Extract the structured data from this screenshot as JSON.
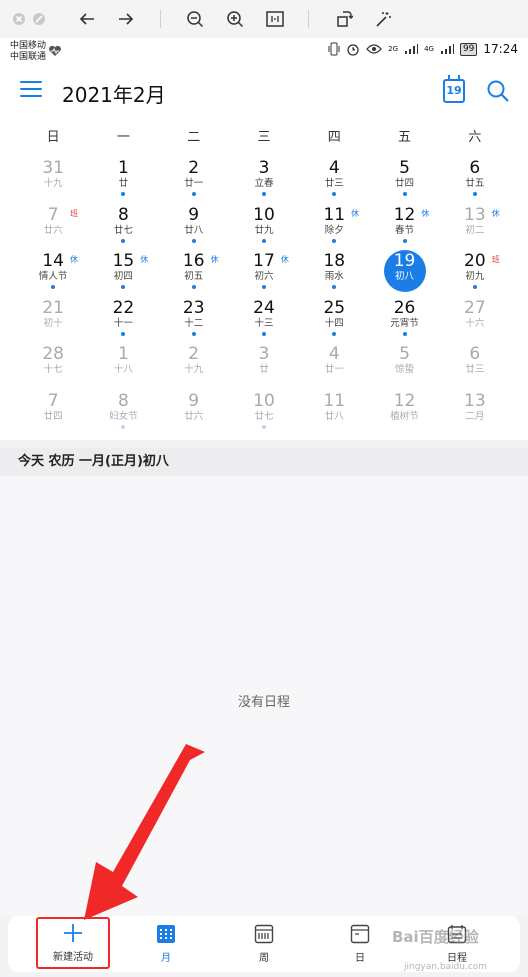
{
  "status": {
    "carrier1": "中国移动",
    "carrier2": "中国联通",
    "net1": "2G",
    "net2": "4G",
    "battery": "99",
    "time": "17:24"
  },
  "header": {
    "title": "2021年2月",
    "today_num": "19"
  },
  "weekdays": [
    "日",
    "一",
    "二",
    "三",
    "四",
    "五",
    "六"
  ],
  "calendar": {
    "selected_day": "19",
    "badge_work": "班",
    "badge_rest": "休",
    "rows": [
      [
        [
          "31",
          "十九",
          true,
          false,
          ""
        ],
        [
          "1",
          "廿",
          false,
          true,
          ""
        ],
        [
          "2",
          "廿一",
          false,
          true,
          ""
        ],
        [
          "3",
          "立春",
          false,
          true,
          ""
        ],
        [
          "4",
          "廿三",
          false,
          true,
          ""
        ],
        [
          "5",
          "廿四",
          false,
          true,
          ""
        ],
        [
          "6",
          "廿五",
          false,
          true,
          ""
        ]
      ],
      [
        [
          "7",
          "廿六",
          true,
          false,
          "ban"
        ],
        [
          "8",
          "廿七",
          false,
          true,
          ""
        ],
        [
          "9",
          "廿八",
          false,
          true,
          ""
        ],
        [
          "10",
          "廿九",
          false,
          true,
          ""
        ],
        [
          "11",
          "除夕",
          false,
          true,
          "xiu"
        ],
        [
          "12",
          "春节",
          false,
          true,
          "xiu"
        ],
        [
          "13",
          "初二",
          true,
          false,
          "xiu"
        ]
      ],
      [
        [
          "14",
          "情人节",
          false,
          true,
          "xiu"
        ],
        [
          "15",
          "初四",
          false,
          true,
          "xiu"
        ],
        [
          "16",
          "初五",
          false,
          true,
          "xiu"
        ],
        [
          "17",
          "初六",
          false,
          true,
          "xiu"
        ],
        [
          "18",
          "雨水",
          false,
          true,
          ""
        ],
        [
          "19",
          "初八",
          false,
          false,
          ""
        ],
        [
          "20",
          "初九",
          false,
          true,
          "ban"
        ]
      ],
      [
        [
          "21",
          "初十",
          true,
          false,
          ""
        ],
        [
          "22",
          "十一",
          false,
          true,
          ""
        ],
        [
          "23",
          "十二",
          false,
          true,
          ""
        ],
        [
          "24",
          "十三",
          false,
          true,
          ""
        ],
        [
          "25",
          "十四",
          false,
          true,
          ""
        ],
        [
          "26",
          "元宵节",
          false,
          true,
          ""
        ],
        [
          "27",
          "十六",
          true,
          false,
          ""
        ]
      ],
      [
        [
          "28",
          "十七",
          true,
          false,
          ""
        ],
        [
          "1",
          "十八",
          true,
          false,
          ""
        ],
        [
          "2",
          "十九",
          true,
          false,
          ""
        ],
        [
          "3",
          "廿",
          true,
          false,
          ""
        ],
        [
          "4",
          "廿一",
          true,
          false,
          ""
        ],
        [
          "5",
          "惊蛰",
          true,
          false,
          ""
        ],
        [
          "6",
          "廿三",
          true,
          false,
          ""
        ]
      ],
      [
        [
          "7",
          "廿四",
          true,
          false,
          ""
        ],
        [
          "8",
          "妇女节",
          true,
          true,
          ""
        ],
        [
          "9",
          "廿六",
          true,
          false,
          ""
        ],
        [
          "10",
          "廿七",
          true,
          true,
          ""
        ],
        [
          "11",
          "廿八",
          true,
          false,
          ""
        ],
        [
          "12",
          "植树节",
          true,
          false,
          ""
        ],
        [
          "13",
          "二月",
          true,
          false,
          ""
        ]
      ]
    ]
  },
  "agenda": {
    "header": "今天  农历 一月(正月)初八",
    "empty": "没有日程"
  },
  "nav": {
    "new": "新建活动",
    "month": "月",
    "week": "周",
    "day": "日",
    "schedule": "日程"
  },
  "watermark": {
    "brand": "Bai百度经验",
    "url": "jingyan.baidu.com"
  },
  "colors": {
    "accent": "#1a7ee6",
    "annotation": "#f02828"
  }
}
